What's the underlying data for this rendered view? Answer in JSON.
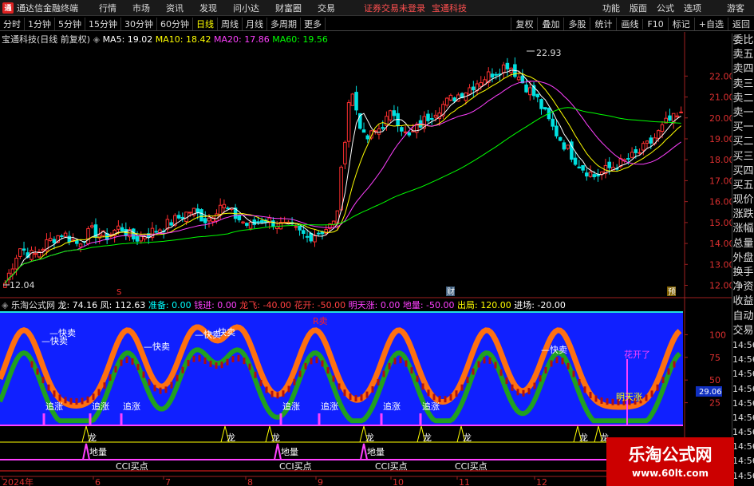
{
  "menubar": {
    "app_title": "通达信金融终端",
    "items": [
      "行情",
      "市场",
      "资讯",
      "发现",
      "问小达",
      "财富圈",
      "交易"
    ],
    "notice": "证券交易未登录",
    "notice2": "宝通科技",
    "right_items": [
      "功能",
      "版面",
      "公式",
      "选项"
    ],
    "guest": "游客"
  },
  "toolbar": {
    "periods": [
      "分时",
      "1分钟",
      "5分钟",
      "15分钟",
      "30分钟",
      "60分钟",
      "日线",
      "周线",
      "月线",
      "多周期",
      "更多"
    ],
    "active_period": "日线",
    "right_items": [
      "复权",
      "叠加",
      "多股",
      "统计",
      "画线",
      "F10",
      "标记",
      "+自选",
      "返回"
    ]
  },
  "main_info": {
    "stock": "宝通科技(日线 前复权)",
    "ma5": "MA5: 19.02",
    "ma10": "MA10: 18.42",
    "ma20": "MA20: 17.86",
    "ma60": "MA60: 19.56"
  },
  "sub_info": {
    "name": "乐淘公式网",
    "long": "龙: 74.16",
    "feng": "凤: 112.63",
    "zhunbei": "准备: 0.00",
    "qianjin": "钱进: 0.00",
    "longfei": "龙飞: -40.00",
    "huakai": "花开: -50.00",
    "mingtian": "明天涨: 0.00",
    "diliang": "地量: -50.00",
    "chuju": "出局: 120.00",
    "jinchang": "进场: -20.00"
  },
  "side_panel": [
    "委比",
    "卖五",
    "卖四",
    "卖三",
    "卖二",
    "卖一",
    "买一",
    "买二",
    "买三",
    "买四",
    "买五",
    "现价",
    "涨跌",
    "涨幅",
    "总量",
    "外盘",
    "换手",
    "净资",
    "收益",
    "自动",
    "交易",
    "14:56",
    "14:56",
    "14:56",
    "14:56",
    "14:56",
    "14:56",
    "14:56",
    "14:56",
    "14:56",
    "14:56"
  ],
  "chart_data": [
    {
      "type": "candlestick",
      "title": "宝通科技(日线 前复权)",
      "ylim": [
        11.6,
        23.5
      ],
      "yticks": [
        12.0,
        13.0,
        14.0,
        15.0,
        16.0,
        17.0,
        18.0,
        19.0,
        20.0,
        21.0,
        22.0
      ],
      "high_label": "22.93",
      "low_label": "12.04",
      "series": [
        {
          "name": "MA5",
          "value": 19.02,
          "color": "#ffffff"
        },
        {
          "name": "MA10",
          "value": 18.42,
          "color": "#ffff00"
        },
        {
          "name": "MA20",
          "value": 17.86,
          "color": "#ff40ff"
        },
        {
          "name": "MA60",
          "value": 19.56,
          "color": "#00ff00"
        }
      ],
      "close_path": [
        12.1,
        13.8,
        13.4,
        14.1,
        14.5,
        14.0,
        14.6,
        14.3,
        14.8,
        14.2,
        14.5,
        14.8,
        15.2,
        15.6,
        15.1,
        15.9,
        15.3,
        14.8,
        15.2,
        14.9,
        14.7,
        14.3,
        14.6,
        15.0,
        21.5,
        18.9,
        19.5,
        20.3,
        19.0,
        19.8,
        20.4,
        20.9,
        21.3,
        21.8,
        22.2,
        22.6,
        21.7,
        20.9,
        19.6,
        18.6,
        17.7,
        17.2,
        17.6,
        17.9,
        18.3,
        18.9,
        19.8,
        20.1
      ],
      "markers": [
        "S",
        "财",
        "预"
      ]
    },
    {
      "type": "area",
      "title": "乐淘公式网",
      "ylim": [
        0,
        125
      ],
      "yticks": [
        25,
        50,
        75,
        100
      ],
      "current_value": "29.06",
      "x_dates": [
        "2024年",
        "6",
        "7",
        "8",
        "9",
        "10",
        "11",
        "12"
      ],
      "labels": [
        "快卖",
        "快卖",
        "快卖",
        "快卖",
        "快卖",
        "快卖",
        "追涨",
        "追涨",
        "追涨",
        "追涨",
        "追涨",
        "追涨",
        "追涨",
        "地量",
        "地量",
        "地量",
        "CCI买点",
        "CCI买点",
        "CCI买点",
        "CCI买点",
        "花开了",
        "明天涨",
        "R卖",
        "龙"
      ]
    }
  ],
  "watermark": {
    "line1": "乐淘公式网",
    "line2": "www.60lt.com"
  }
}
